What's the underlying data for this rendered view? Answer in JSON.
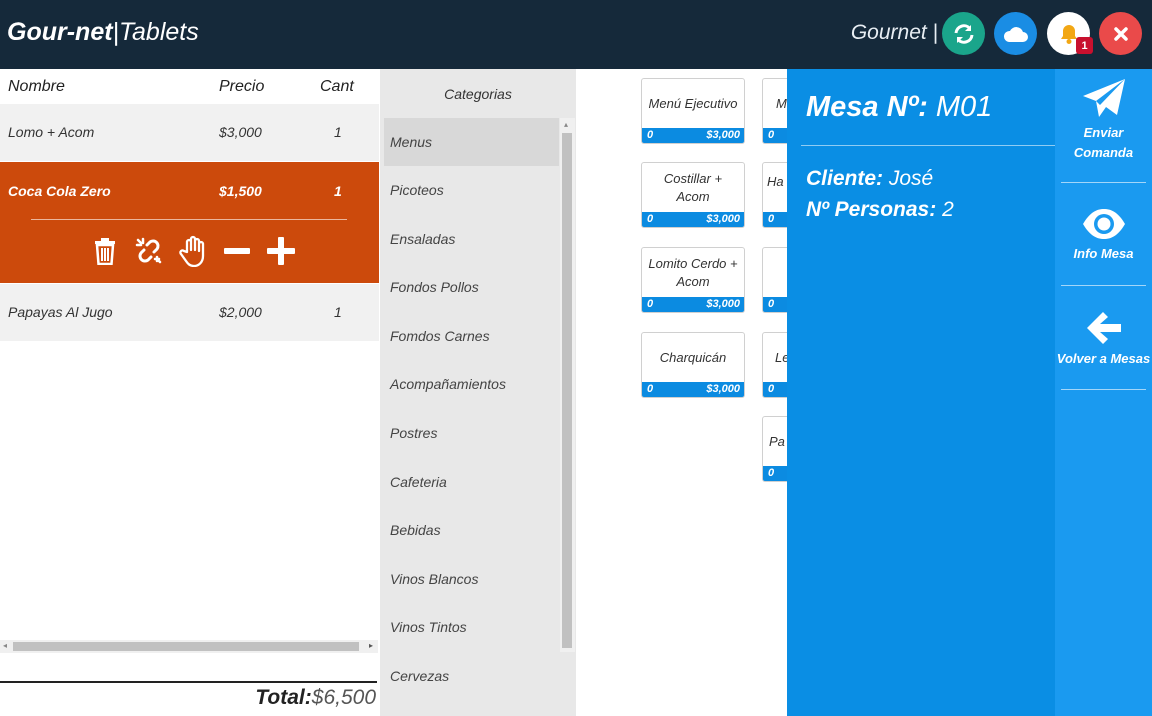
{
  "header": {
    "brand_bold": "Gour-net",
    "brand_sep": "|",
    "brand_light": "Tablets",
    "user_label": "Gournet |",
    "notifications_count": "1",
    "colors": {
      "bar": "#15293a",
      "sync": "#1aa58b",
      "cloud": "#1a8de4",
      "close": "#ea4a4a"
    }
  },
  "order": {
    "columns": {
      "name": "Nombre",
      "price": "Precio",
      "qty": "Cant"
    },
    "items": [
      {
        "name": "Lomo + Acom",
        "price": "$3,000",
        "qty": "1"
      },
      {
        "name": "Coca Cola Zero",
        "price": "$1,500",
        "qty": "1"
      },
      {
        "name": "Papayas Al Jugo",
        "price": "$2,000",
        "qty": "1"
      }
    ],
    "selected_index": 1,
    "actions": [
      "trash-icon",
      "unlink-icon",
      "hand-icon",
      "minus-icon",
      "plus-icon"
    ],
    "total_label": "Total:",
    "total_value": "$6,500",
    "selected_color": "#cc4a0c"
  },
  "categories": {
    "title": "Categorias",
    "items": [
      "Menus",
      "Picoteos",
      "Ensaladas",
      "Fondos Pollos",
      "Fomdos Carnes",
      "Acompañamientos",
      "Postres",
      "Cafeteria",
      "Bebidas",
      "Vinos Blancos",
      "Vinos Tintos",
      "Cervezas"
    ],
    "active_index": 0
  },
  "products": {
    "col1": [
      {
        "name": "Menú Ejecutivo",
        "qty": "0",
        "price": "$3,000"
      },
      {
        "name": "Costillar + Acom",
        "qty": "0",
        "price": "$3,000"
      },
      {
        "name": "Lomito Cerdo + Acom",
        "qty": "0",
        "price": "$3,000"
      },
      {
        "name": "Charquicán",
        "qty": "0",
        "price": "$3,000"
      }
    ],
    "col2": [
      {
        "name": "M",
        "qty": "0"
      },
      {
        "name": "Ha",
        "qty": "0"
      },
      {
        "name": "",
        "qty": "0"
      },
      {
        "name": "Le",
        "qty": "0"
      },
      {
        "name": "Pa",
        "qty": "0"
      }
    ]
  },
  "table_panel": {
    "mesa_label": "Mesa Nº:",
    "mesa_value": "M01",
    "client_label": "Cliente:",
    "client_value": "José",
    "persons_label": "Nº Personas:",
    "persons_value": "2",
    "color": "#0a8ee4"
  },
  "sidebar": {
    "send_label_1": "Enviar",
    "send_label_2": "Comanda",
    "info_label": "Info Mesa",
    "back_label": "Volver a Mesas"
  }
}
